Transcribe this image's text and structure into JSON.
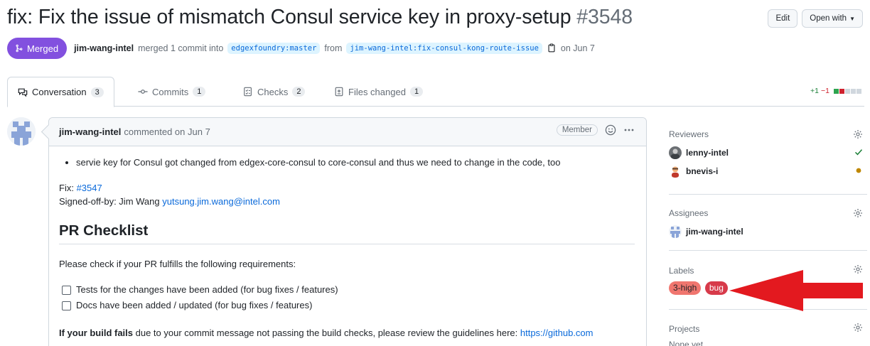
{
  "pr": {
    "title": "fix: Fix the issue of mismatch Consul service key in proxy-setup",
    "number": "#3548",
    "state": "Merged",
    "author": "jim-wang-intel",
    "merge_text": "merged 1 commit into",
    "base_branch": "edgexfoundry:master",
    "from_text": "from",
    "head_branch": "jim-wang-intel:fix-consul-kong-route-issue",
    "date_text": "on Jun 7"
  },
  "header_buttons": {
    "edit": "Edit",
    "open_with": "Open with"
  },
  "tabs": [
    {
      "label": "Conversation",
      "count": "3",
      "icon": "conversation-icon"
    },
    {
      "label": "Commits",
      "count": "1",
      "icon": "commit-icon"
    },
    {
      "label": "Checks",
      "count": "2",
      "icon": "checks-icon"
    },
    {
      "label": "Files changed",
      "count": "1",
      "icon": "file-diff-icon"
    }
  ],
  "diffstat": {
    "additions": "+1",
    "deletions": "−1"
  },
  "comment": {
    "author": "jim-wang-intel",
    "action": "commented on Jun 7",
    "role": "Member",
    "bullet": "servie key for Consul got changed from edgex-core-consul to core-consul and thus we need to change in the code, too",
    "fix_label": "Fix:",
    "fix_link": "#3547",
    "signed_off": "Signed-off-by: Jim Wang",
    "email": "yutsung.jim.wang@intel.com",
    "checklist_heading": "PR Checklist",
    "checklist_intro": "Please check if your PR fulfills the following requirements:",
    "tasks": [
      "Tests for the changes have been added (for bug fixes / features)",
      "Docs have been added / updated (for bug fixes / features)"
    ],
    "build_bold": "If your build fails",
    "build_text": " due to your commit message not passing the build checks, please review the guidelines here: ",
    "build_link": "https://github.com"
  },
  "sidebar": {
    "reviewers_title": "Reviewers",
    "reviewers": [
      {
        "name": "lenny-intel",
        "status": "approved"
      },
      {
        "name": "bnevis-i",
        "status": "pending"
      }
    ],
    "assignees_title": "Assignees",
    "assignees": [
      {
        "name": "jim-wang-intel"
      }
    ],
    "labels_title": "Labels",
    "labels": [
      {
        "name": "3-high",
        "color": "#f0766f"
      },
      {
        "name": "bug",
        "color": "#d73a4a"
      }
    ],
    "projects_title": "Projects",
    "projects_value": "None yet"
  },
  "colors": {
    "merged": "#8250df",
    "link": "#0969da",
    "annotation_arrow": "#e3191f"
  }
}
